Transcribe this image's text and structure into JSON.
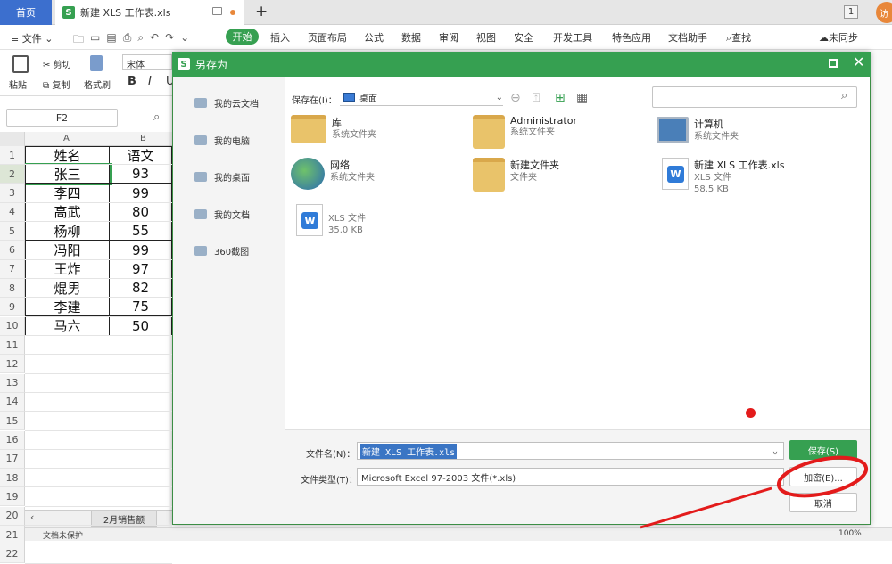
{
  "tabs": {
    "home": "首页",
    "doc": "新建 XLS 工作表.xls",
    "plus": "+",
    "window_count": "1",
    "user": "访"
  },
  "menu": {
    "file": "文件",
    "items": [
      "开始",
      "插入",
      "页面布局",
      "公式",
      "数据",
      "审阅",
      "视图",
      "安全",
      "开发工具",
      "特色应用",
      "文档助手",
      "查找"
    ],
    "sync": "未同步"
  },
  "ribbon": {
    "paste": "粘贴",
    "cut": "剪切",
    "copy": "复制",
    "format_painter": "格式刷",
    "font": "宋体",
    "bold": "B",
    "italic": "I",
    "underline": "U"
  },
  "formula": {
    "name_box": "F2"
  },
  "sheet": {
    "col_a": "A",
    "col_b": "B",
    "header": [
      "姓名",
      "语文"
    ],
    "rows": [
      [
        "张三",
        "93"
      ],
      [
        "李四",
        "99"
      ],
      [
        "高武",
        "80"
      ],
      [
        "杨柳",
        "55"
      ],
      [
        "冯阳",
        "99"
      ],
      [
        "王炸",
        "97"
      ],
      [
        "焜男",
        "82"
      ],
      [
        "李建",
        "75"
      ],
      [
        "马六",
        "50"
      ]
    ],
    "row_numbers": [
      "1",
      "2",
      "3",
      "4",
      "5",
      "6",
      "7",
      "8",
      "9",
      "10",
      "11",
      "12",
      "13",
      "14",
      "15",
      "16",
      "17",
      "18",
      "19",
      "20",
      "21",
      "22"
    ],
    "sheet_tab": "2月销售额",
    "status": "文档未保护",
    "zoom": "100%"
  },
  "dialog": {
    "title": "另存为",
    "sidebar": [
      "我的云文档",
      "我的电脑",
      "我的桌面",
      "我的文档",
      "360截图"
    ],
    "save_in_label": "保存在(I)：",
    "location": "桌面",
    "files": [
      {
        "name": "库",
        "sub": "系统文件夹"
      },
      {
        "name": "Administrator",
        "sub": "系统文件夹"
      },
      {
        "name": "计算机",
        "sub": "系统文件夹"
      },
      {
        "name": "网络",
        "sub": "系统文件夹"
      },
      {
        "name": "新建文件夹",
        "sub": "文件夹"
      },
      {
        "name": "新建 XLS 工作表.xls",
        "sub": "XLS 文件",
        "size": "58.5 KB"
      },
      {
        "name": "",
        "sub": "XLS 文件",
        "size": "35.0 KB"
      }
    ],
    "filename_label": "文件名(N)：",
    "filename_value": "新建 XLS 工作表.xls",
    "filetype_label": "文件类型(T)：",
    "filetype_value": "Microsoft Excel 97-2003 文件(*.xls)",
    "save_button": "保存(S)",
    "encrypt_button": "加密(E)...",
    "cancel_button": "取消"
  },
  "colors": {
    "accent": "#36a051",
    "tab_blue": "#3c6fce",
    "annotation": "#e31b1b"
  }
}
